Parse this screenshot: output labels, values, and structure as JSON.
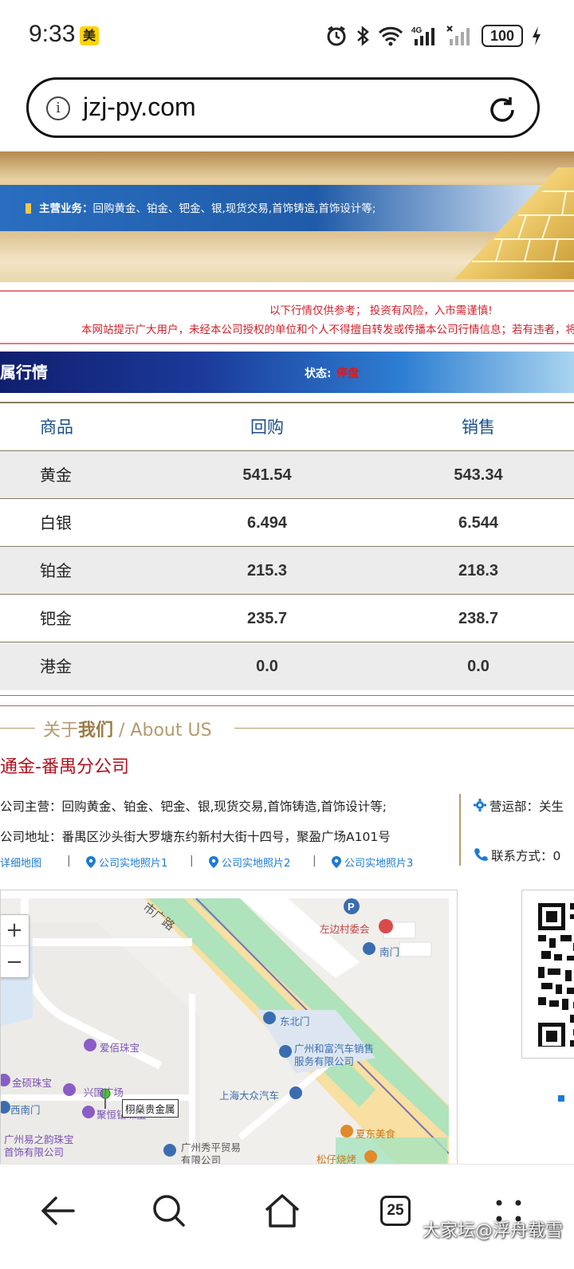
{
  "status_bar": {
    "time": "9:33",
    "app_badge": "美",
    "battery": "100",
    "network": "4G"
  },
  "browser": {
    "url": "jzj-py.com"
  },
  "banner": {
    "label": "主营业务：",
    "text_prefix": "回购",
    "text_bold": "黄金、铂金、钯金、银,现货交易,首饰铸造,首饰设计等;"
  },
  "notice": {
    "line1": "以下行情仅供参考； 投资有风险，入市需谨慎!",
    "line2": "本网站提示广大用户，未经本公司授权的单位和个人不得擅自转发或传播本公司行情信息；若有违者，将"
  },
  "market": {
    "title": "属行情",
    "status_label": "状态:",
    "status_value": "停盘"
  },
  "price_table": {
    "headers": [
      "商品",
      "回购",
      "销售"
    ],
    "rows": [
      {
        "name": "黄金",
        "buy": "541.54",
        "sell": "543.34"
      },
      {
        "name": "白银",
        "buy": "6.494",
        "sell": "6.544"
      },
      {
        "name": "铂金",
        "buy": "215.3",
        "sell": "218.3"
      },
      {
        "name": "钯金",
        "buy": "235.7",
        "sell": "238.7"
      },
      {
        "name": "港金",
        "buy": "0.0",
        "sell": "0.0"
      }
    ]
  },
  "about": {
    "title_plain": "关于",
    "title_bold": "我们",
    "title_en": " / About US",
    "company": "通金-番禺分公司",
    "business": "公司主营：回购黄金、铂金、钯金、银,现货交易,首饰铸造,首饰设计等;",
    "address": "公司地址：番禺区沙头街大罗塘东约新村大街十四号，聚盈广场A101号",
    "ops_label": "营运部：关生",
    "contact_label": "联系方式：0",
    "links": [
      "详细地图",
      "公司实地照片1",
      "公司实地照片2",
      "公司实地照片3"
    ],
    "link_separator": "|"
  },
  "map": {
    "zoom_in": "+",
    "zoom_out": "−",
    "labels": {
      "road": "市广路",
      "village": "左边村委会",
      "south_gate": "南门",
      "northeast_gate": "东北门",
      "car_sales_1": "广州和富汽车销售",
      "car_sales_2": "服务有限公司",
      "aibei": "爱佰珠宝",
      "jinshuo": "金硕珠宝",
      "xingguo": "兴国广场",
      "west_south_gate": "西南门",
      "juheng": "聚恒钻珠宝",
      "marker": "栩燊贵金属",
      "vw": "上海大众汽车",
      "xiadong": "夏东美食",
      "yizhiyun_1": "广州易之韵珠宝",
      "yizhiyun_2": "首饰有限公司",
      "xiuping_1": "广州秀平贸易",
      "xiuping_2": "有限公司",
      "songzai": "松仔烧烤"
    }
  },
  "bottom_nav": {
    "tab_count": "25"
  },
  "watermark": "大家坛@浮舟载雪",
  "colors": {
    "accent_red": "#d0202a",
    "table_header_blue": "#1b4f8a",
    "gold_line": "#b49a6e",
    "link_blue": "#1b7ad6"
  }
}
